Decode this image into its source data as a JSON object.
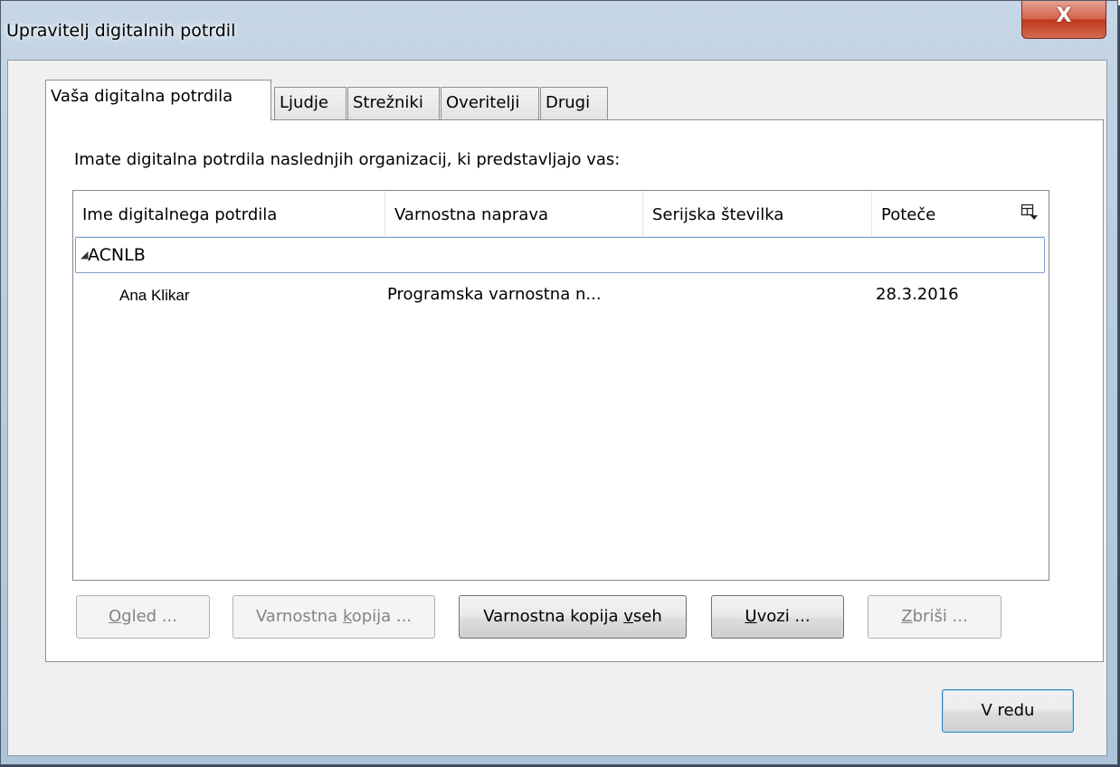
{
  "window": {
    "title": "Upravitelj digitalnih potrdil",
    "close_glyph": "X"
  },
  "tabs": [
    {
      "label": "Vaša digitalna potrdila",
      "active": true
    },
    {
      "label": "Ljudje",
      "active": false
    },
    {
      "label": "Strežniki",
      "active": false
    },
    {
      "label": "Overitelji",
      "active": false
    },
    {
      "label": "Drugi",
      "active": false
    }
  ],
  "panel": {
    "intro": "Imate digitalna potrdila naslednjih organizacij, ki predstavljajo vas:"
  },
  "table": {
    "columns": [
      "Ime digitalnega potrdila",
      "Varnostna naprava",
      "Serijska številka",
      "Poteče"
    ],
    "column_picker_icon": "column-picker-icon",
    "group": {
      "expander": "◢",
      "name": "ACNLB"
    },
    "rows": [
      {
        "name": "Ana Klikar",
        "device": "Programska varnostna n...",
        "serial": "",
        "expires": "28.3.2016"
      }
    ]
  },
  "buttons": {
    "view": {
      "pre": "",
      "key": "O",
      "post": "gled ..."
    },
    "backup": {
      "pre": "Varnostna ",
      "key": "k",
      "post": "opija ..."
    },
    "backup_all": {
      "pre": "Varnostna kopija ",
      "key": "v",
      "post": "seh"
    },
    "import": {
      "pre": "",
      "key": "U",
      "post": "vozi ..."
    },
    "delete": {
      "pre": "",
      "key": "Z",
      "post": "briši ..."
    },
    "ok": "V redu"
  }
}
